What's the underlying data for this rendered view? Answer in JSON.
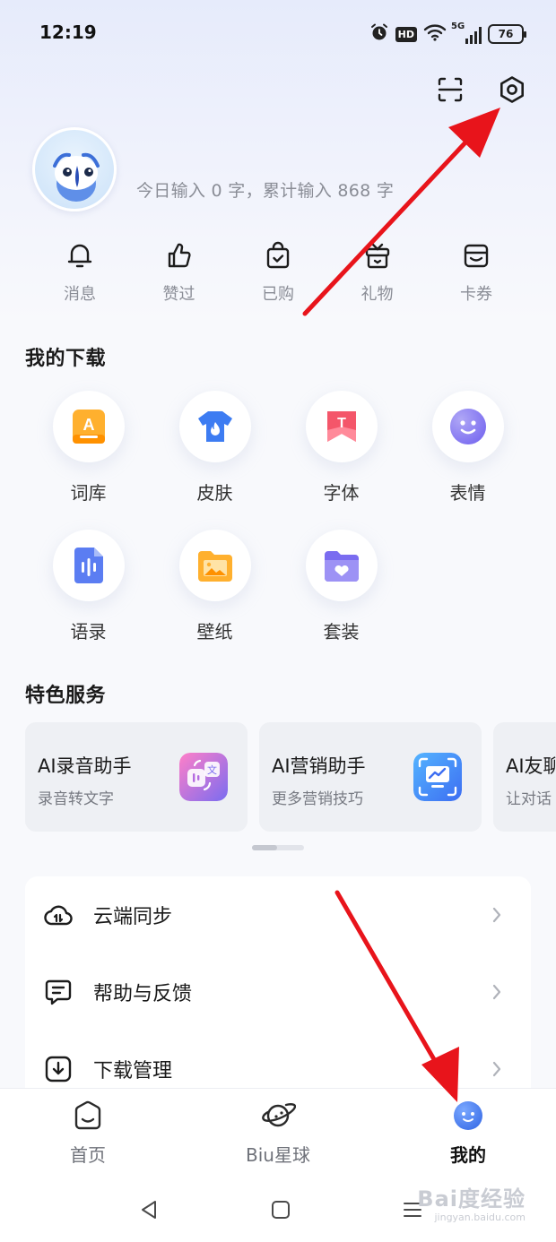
{
  "status_bar": {
    "time": "12:19",
    "hd_label": "HD",
    "network_label": "5G",
    "battery": "76"
  },
  "profile": {
    "stats": "今日输入 0 字，累计输入 868 字"
  },
  "quick_actions": [
    {
      "label": "消息",
      "icon": "bell-icon"
    },
    {
      "label": "赞过",
      "icon": "thumbs-up-icon"
    },
    {
      "label": "已购",
      "icon": "shopping-bag-icon"
    },
    {
      "label": "礼物",
      "icon": "gift-icon"
    },
    {
      "label": "卡券",
      "icon": "coupon-icon"
    }
  ],
  "downloads": {
    "title": "我的下载",
    "items": [
      {
        "label": "词库",
        "icon": "lexicon-icon",
        "color": "#ffb02e"
      },
      {
        "label": "皮肤",
        "icon": "skin-icon",
        "color": "#3d7cf2"
      },
      {
        "label": "字体",
        "icon": "font-icon",
        "color": "#f4566a"
      },
      {
        "label": "表情",
        "icon": "emoji-icon",
        "color": "#7a6cf0"
      },
      {
        "label": "语录",
        "icon": "quotes-icon",
        "color": "#5b7df2"
      },
      {
        "label": "壁纸",
        "icon": "wallpaper-icon",
        "color": "#ffb02e"
      },
      {
        "label": "套装",
        "icon": "bundle-icon",
        "color": "#7a6cf0"
      }
    ]
  },
  "services": {
    "title": "特色服务",
    "cards": [
      {
        "title": "AI录音助手",
        "subtitle": "录音转文字",
        "icon": "ai-recording-icon"
      },
      {
        "title": "AI营销助手",
        "subtitle": "更多营销技巧",
        "icon": "ai-marketing-icon"
      },
      {
        "title": "AI友聊",
        "subtitle": "让对话",
        "icon": "ai-chat-icon"
      }
    ]
  },
  "menu": [
    {
      "label": "云端同步",
      "icon": "cloud-sync-icon"
    },
    {
      "label": "帮助与反馈",
      "icon": "feedback-icon"
    },
    {
      "label": "下载管理",
      "icon": "download-icon"
    }
  ],
  "bottom_nav": [
    {
      "label": "首页",
      "icon": "home-icon",
      "active": false
    },
    {
      "label": "Biu星球",
      "icon": "planet-icon",
      "active": false
    },
    {
      "label": "我的",
      "icon": "profile-face-icon",
      "active": true
    }
  ],
  "watermark": {
    "text": "Bai度经验",
    "url_text": "jingyan.baidu.com"
  },
  "colors": {
    "accent": "#4a7cf0",
    "annotation_arrow": "#e8141b"
  }
}
